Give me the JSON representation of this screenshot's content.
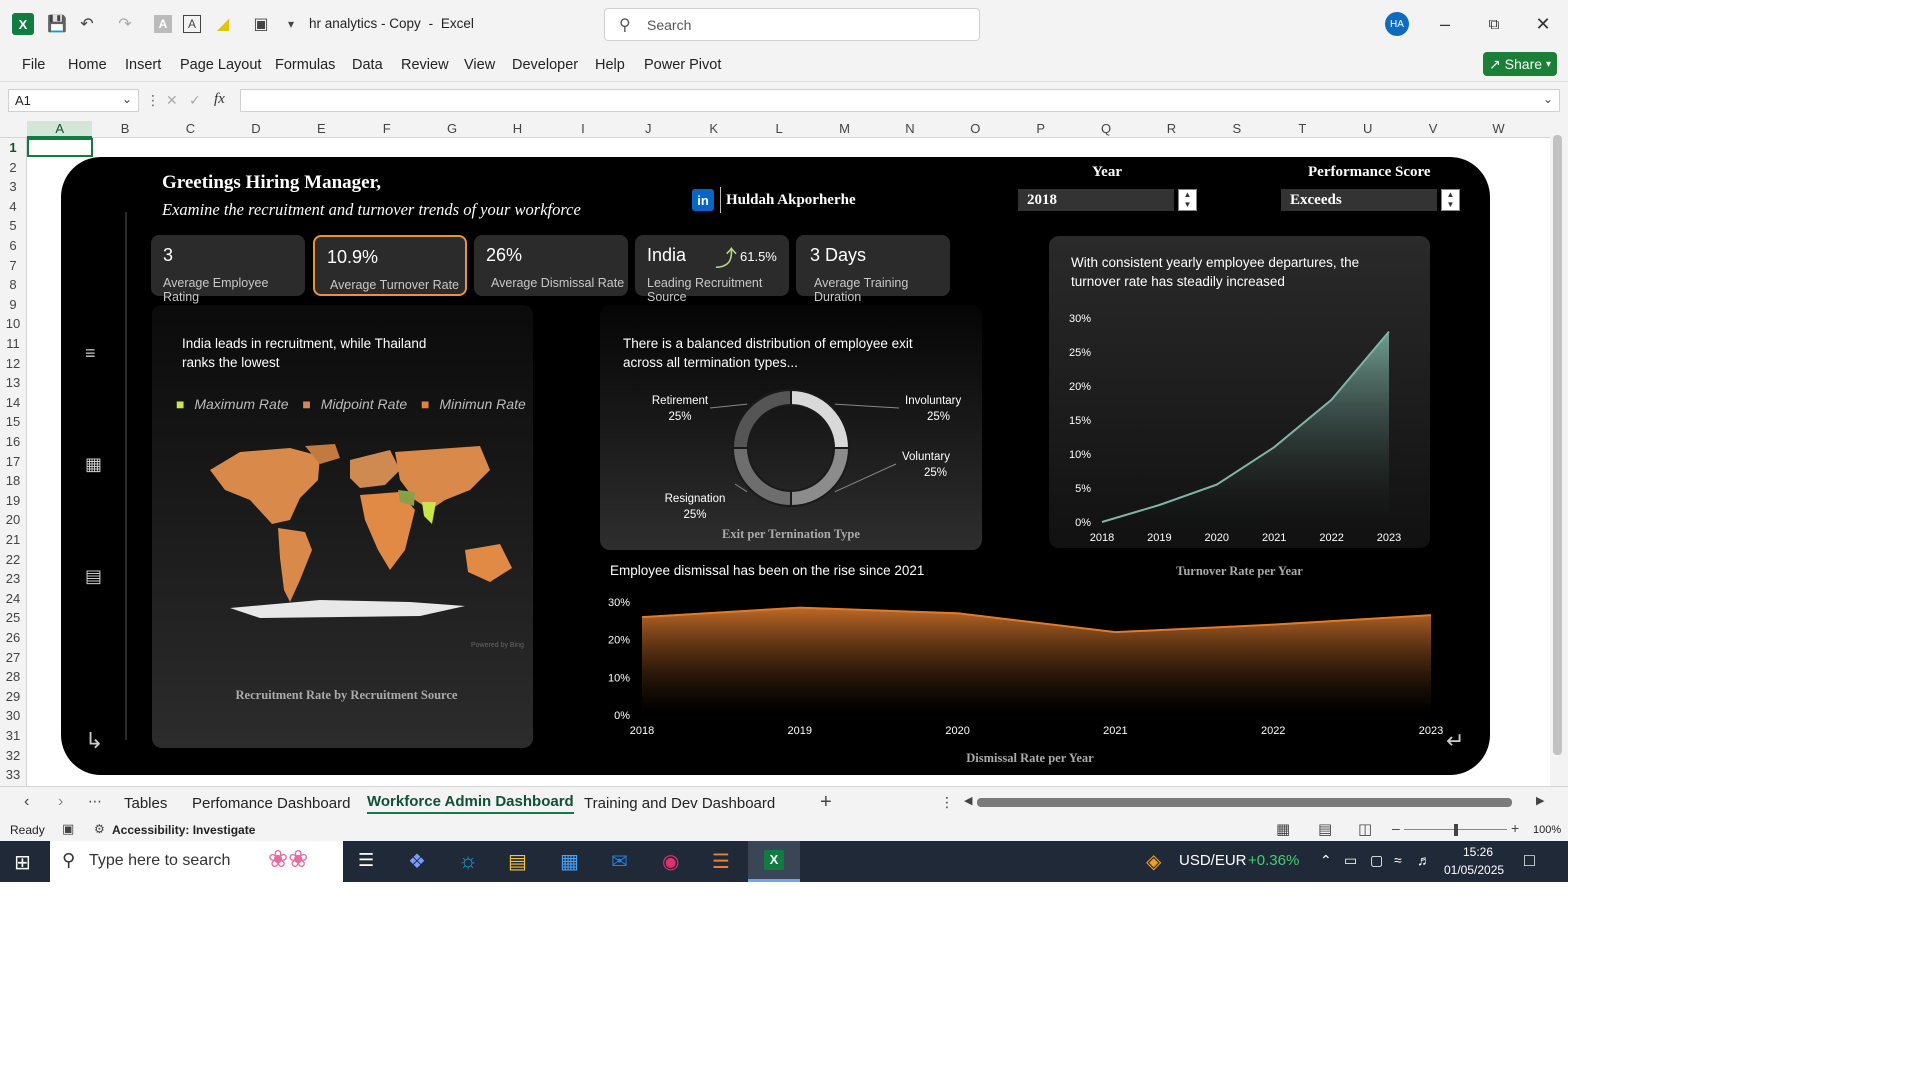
{
  "window": {
    "doc_title": "hr analytics - Copy",
    "app_name": "Excel",
    "search_placeholder": "Search",
    "avatar": "HA"
  },
  "menu": [
    "File",
    "Home",
    "Insert",
    "Page Layout",
    "Formulas",
    "Data",
    "Review",
    "View",
    "Developer",
    "Help",
    "Power Pivot"
  ],
  "share_label": "Share",
  "namebox": "A1",
  "fx": "fx",
  "columns": [
    "A",
    "B",
    "C",
    "D",
    "E",
    "F",
    "G",
    "H",
    "I",
    "J",
    "K",
    "L",
    "M",
    "N",
    "O",
    "P",
    "Q",
    "R",
    "S",
    "T",
    "U",
    "V",
    "W"
  ],
  "rows": [
    "1",
    "2",
    "3",
    "4",
    "5",
    "6",
    "7",
    "8",
    "9",
    "10",
    "11",
    "12",
    "13",
    "14",
    "15",
    "16",
    "17",
    "18",
    "19",
    "20",
    "21",
    "22",
    "23",
    "24",
    "25",
    "26",
    "27",
    "28",
    "29",
    "30",
    "31",
    "32",
    "33"
  ],
  "dashboard": {
    "greeting": "Greetings Hiring Manager,",
    "subtitle": "Examine the recruitment and turnover trends of  your workforce",
    "author": "Huldah Akporherhe",
    "year_label": "Year",
    "year_value": "2018",
    "perf_label": "Performance Score",
    "perf_value": "Exceeds",
    "kpis": [
      {
        "value": "3",
        "label": "Average Employee Rating"
      },
      {
        "value": "10.9%",
        "label": "Average Turnover Rate"
      },
      {
        "value": "26%",
        "label": "Average Dismissal Rate"
      },
      {
        "value": "India",
        "extra": "61.5%",
        "label": "Leading Recruitment Source"
      },
      {
        "value": "3 Days",
        "label": "Average Training Duration"
      }
    ],
    "map_card": {
      "headline": "India leads in recruitment, while Thailand ranks the lowest",
      "legend": [
        "Maximum Rate",
        "Midpoint Rate",
        "Minimun Rate"
      ],
      "legend_colors": [
        "#c8e64c",
        "#d4875a",
        "#e8803a"
      ],
      "credit": "Powered by Bing",
      "title": "Recruitment Rate by Recruitment Source"
    },
    "donut_card": {
      "headline": "There is a balanced distribution of employee exit across all termination types...",
      "title": "Exit per Ternination Type"
    },
    "turnover_card": {
      "headline": "With consistent yearly employee departures, the turnover rate has steadily increased",
      "title": "Turnover Rate per Year"
    },
    "dismissal_card": {
      "headline": "Employee dismissal has been on the rise since 2021",
      "title": "Dismissal Rate per Year"
    }
  },
  "chart_data": [
    {
      "type": "pie",
      "title": "Exit per Ternination Type",
      "categories": [
        "Involuntary",
        "Voluntary",
        "Resignation",
        "Retirement"
      ],
      "values": [
        25,
        25,
        25,
        25
      ],
      "labels": [
        "25%",
        "25%",
        "25%",
        "25%"
      ],
      "colors": [
        "#d9d9d9",
        "#8c8c8c",
        "#6e6e6e",
        "#555555"
      ]
    },
    {
      "type": "area",
      "title": "Turnover Rate per Year",
      "x": [
        "2018",
        "2019",
        "2020",
        "2021",
        "2022",
        "2023"
      ],
      "values": [
        0,
        2.5,
        5.5,
        11,
        18,
        28
      ],
      "ylim": [
        0,
        30
      ],
      "yticks": [
        "0%",
        "5%",
        "10%",
        "15%",
        "20%",
        "25%",
        "30%"
      ],
      "yticks_values": [
        0,
        5,
        10,
        15,
        20,
        25,
        30
      ],
      "color": "#7fb5a5"
    },
    {
      "type": "area",
      "title": "Dismissal Rate per Year",
      "x": [
        "2018",
        "2019",
        "2020",
        "2021",
        "2022",
        "2023"
      ],
      "values": [
        26,
        28.5,
        27,
        22,
        24,
        26.5
      ],
      "ylim": [
        0,
        30
      ],
      "yticks": [
        "0%",
        "10%",
        "20%",
        "30%"
      ],
      "yticks_values": [
        0,
        10,
        20,
        30
      ],
      "color": "#e07b2e"
    }
  ],
  "sheet_tabs": [
    "Tables",
    "Perfomance Dashboard",
    "Workforce Admin Dashboard",
    "Training and Dev Dashboard"
  ],
  "status": {
    "ready": "Ready",
    "accessibility": "Accessibility: Investigate",
    "zoom": "100%"
  },
  "taskbar": {
    "search_placeholder": "Type here to search",
    "ticker": "USD/EUR",
    "ticker_change": "+0.36%",
    "time": "15:26",
    "date": "01/05/2025"
  }
}
